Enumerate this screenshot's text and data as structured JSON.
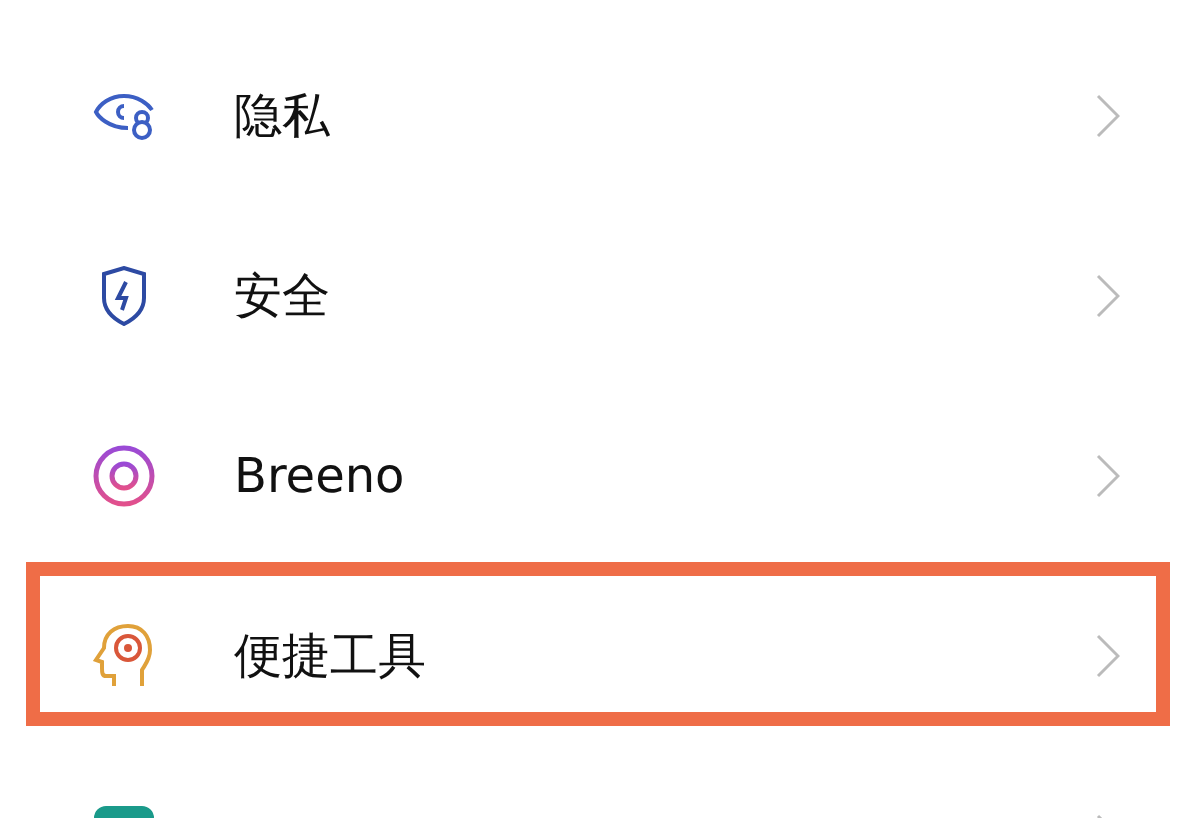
{
  "settings_items": [
    {
      "label": "隐私",
      "highlighted": false
    },
    {
      "label": "安全",
      "highlighted": false
    },
    {
      "label": "Breeno",
      "highlighted": false
    },
    {
      "label": "便捷工具",
      "highlighted": true
    },
    {
      "highlighted": false
    }
  ]
}
